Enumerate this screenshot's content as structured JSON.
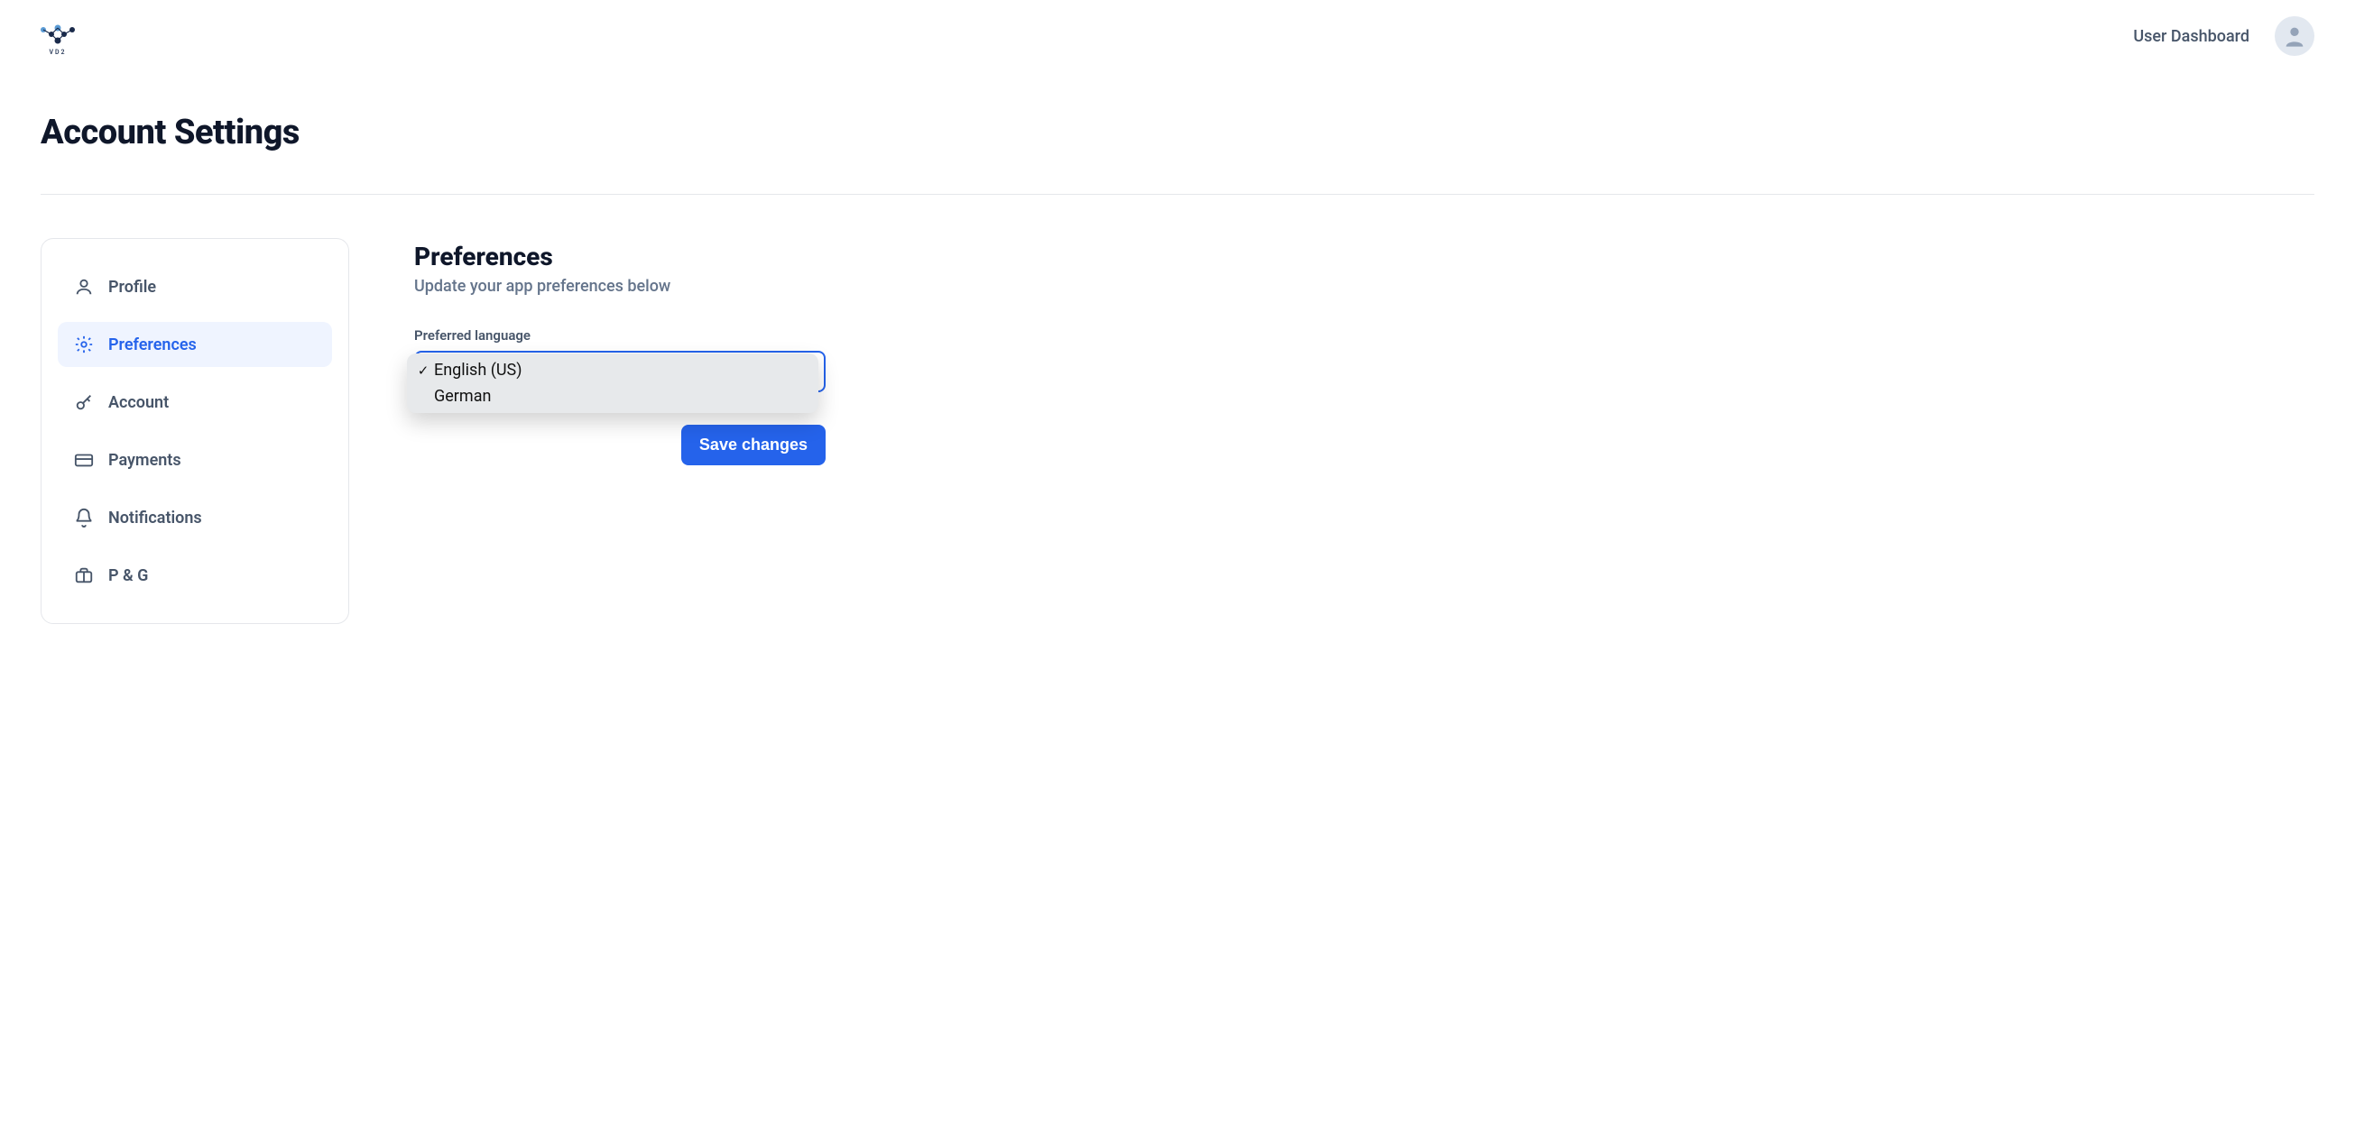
{
  "header": {
    "logo_text": "VD2",
    "dashboard_link": "User Dashboard"
  },
  "page": {
    "title": "Account Settings"
  },
  "sidebar": {
    "items": [
      {
        "label": "Profile",
        "icon": "user-icon",
        "active": false
      },
      {
        "label": "Preferences",
        "icon": "gear-icon",
        "active": true
      },
      {
        "label": "Account",
        "icon": "key-icon",
        "active": false
      },
      {
        "label": "Payments",
        "icon": "card-icon",
        "active": false
      },
      {
        "label": "Notifications",
        "icon": "bell-icon",
        "active": false
      },
      {
        "label": "P & G",
        "icon": "briefcase-icon",
        "active": false
      }
    ]
  },
  "main": {
    "section_title": "Preferences",
    "section_subtitle": "Update your app preferences below",
    "language_label": "Preferred language",
    "dropdown": {
      "selected": "English (US)",
      "options": [
        {
          "label": "English (US)",
          "checked": true
        },
        {
          "label": "German",
          "checked": false
        }
      ]
    },
    "save_label": "Save changes"
  },
  "colors": {
    "accent": "#2563eb"
  }
}
